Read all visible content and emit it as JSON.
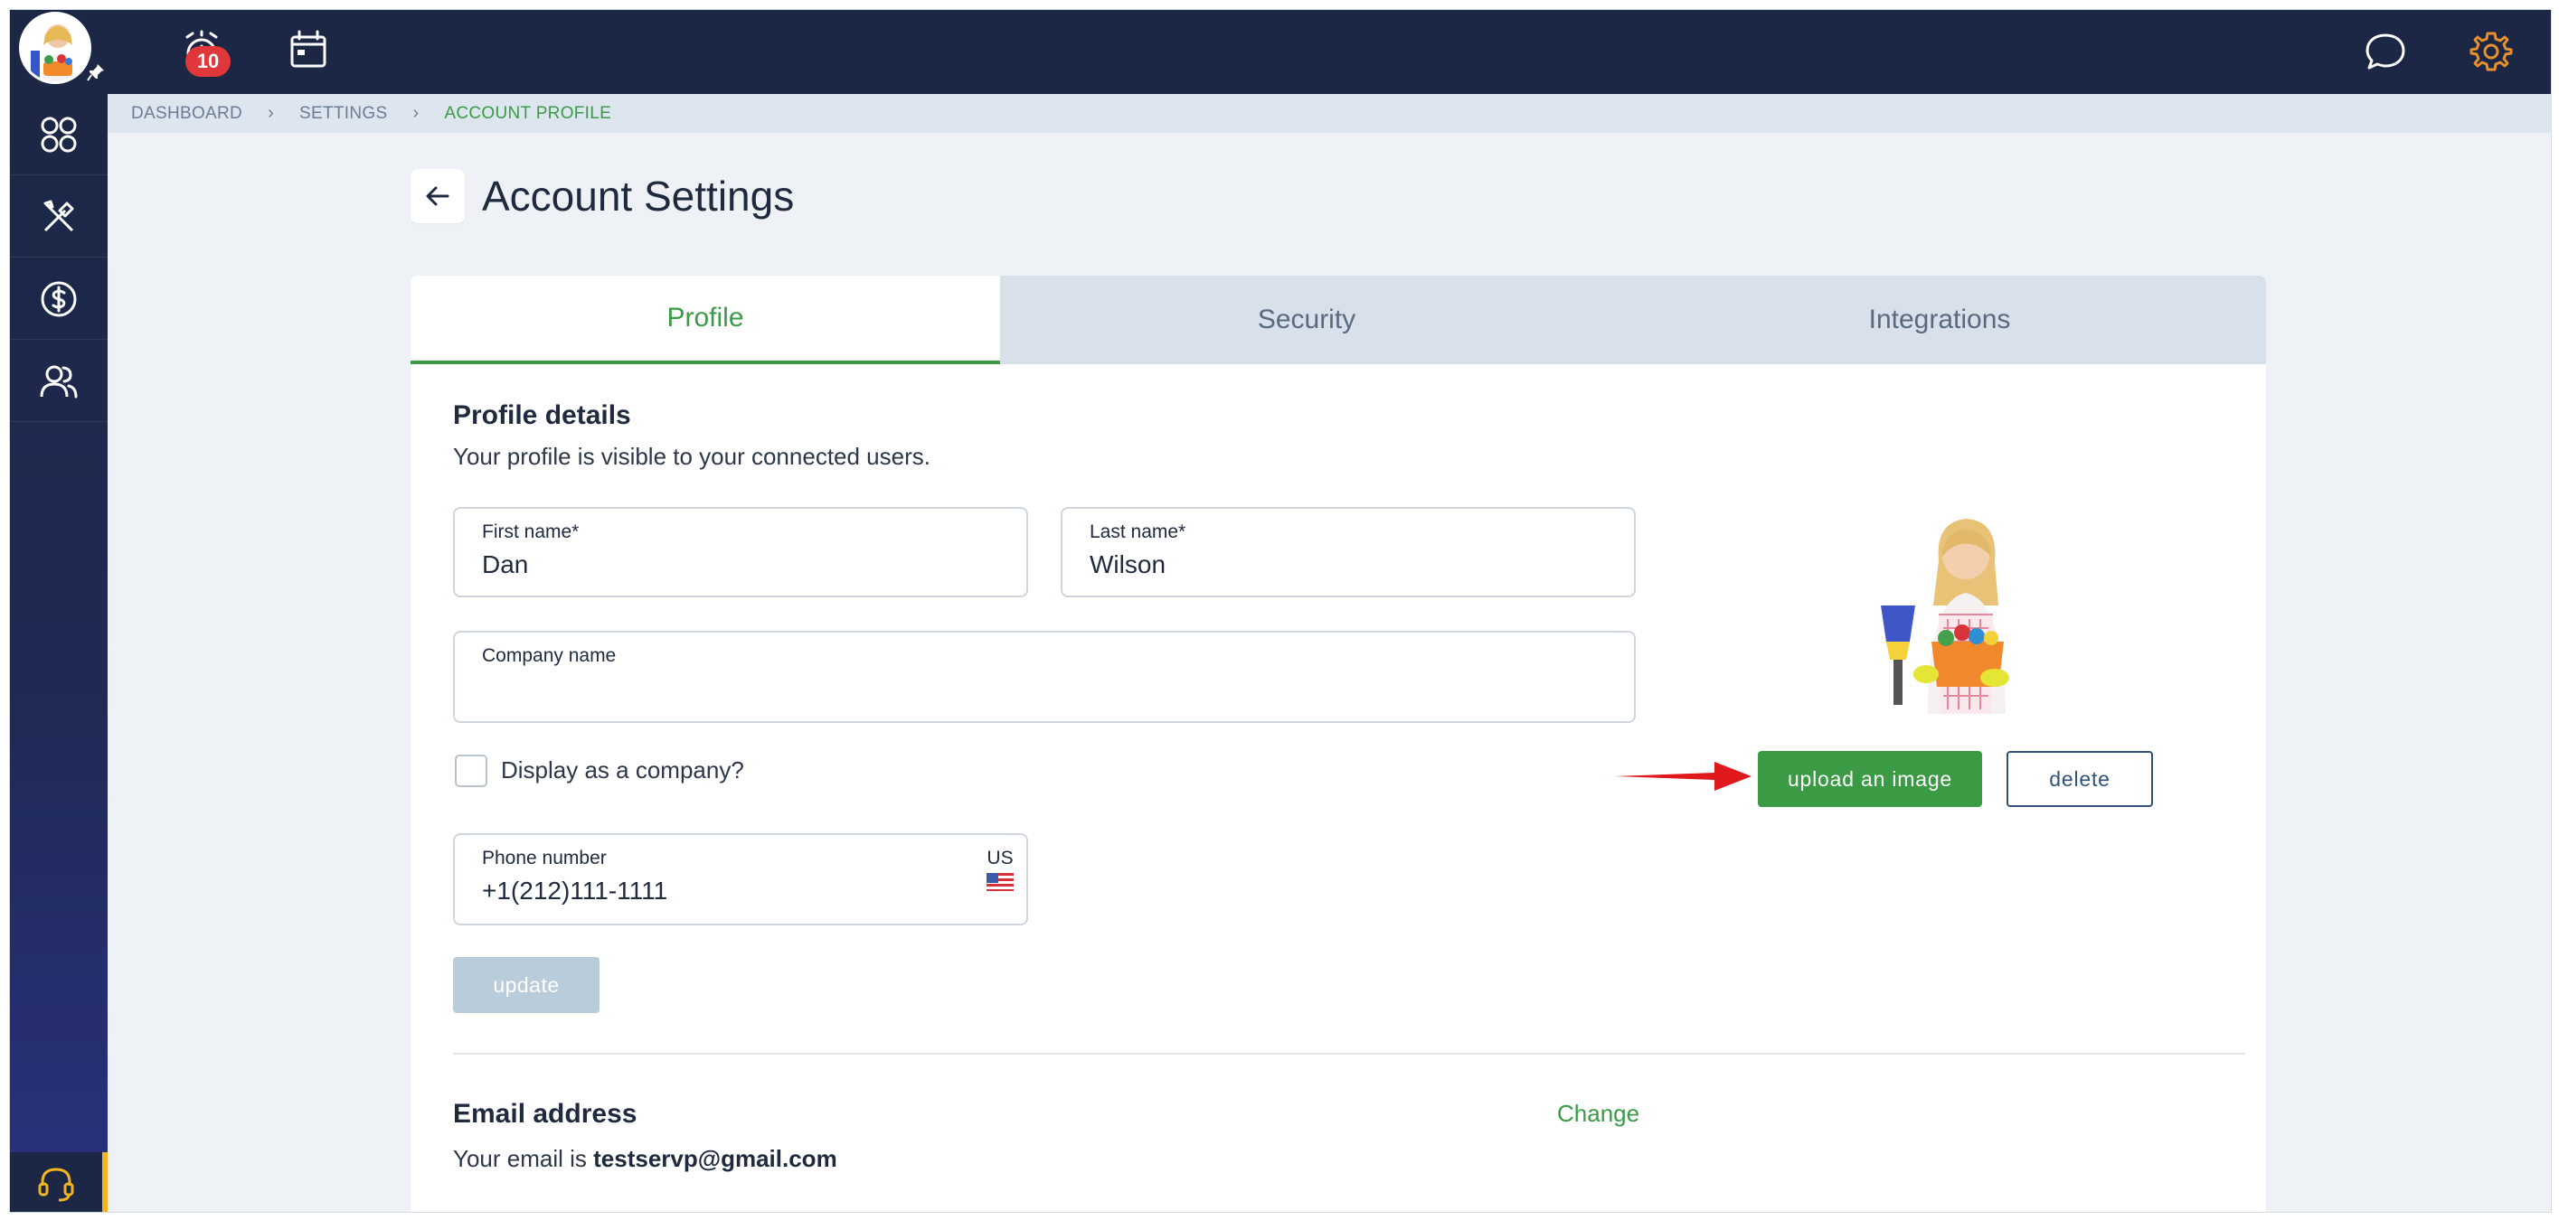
{
  "header": {
    "notification_count": "10"
  },
  "breadcrumb": {
    "items": [
      "DASHBOARD",
      "SETTINGS",
      "ACCOUNT PROFILE"
    ]
  },
  "page": {
    "title": "Account Settings"
  },
  "tabs": [
    {
      "label": "Profile",
      "active": true
    },
    {
      "label": "Security",
      "active": false
    },
    {
      "label": "Integrations",
      "active": false
    }
  ],
  "profile": {
    "section_title": "Profile details",
    "section_subtitle": "Your profile is visible to your connected users.",
    "first_name": {
      "label": "First name*",
      "value": "Dan"
    },
    "last_name": {
      "label": "Last name*",
      "value": "Wilson"
    },
    "company_name": {
      "label": "Company name",
      "value": ""
    },
    "display_as_company": {
      "label": "Display as a company?",
      "checked": false
    },
    "phone": {
      "label": "Phone number",
      "value": "+1(212)111-1111",
      "country": "US"
    },
    "update_label": "update",
    "upload_label": "upload an image",
    "delete_label": "delete"
  },
  "email": {
    "section_title": "Email address",
    "change_label": "Change",
    "prefix": "Your email is",
    "address": "testservp@gmail.com"
  },
  "colors": {
    "brand_navy": "#1b2744",
    "accent_green": "#3b9b46",
    "badge_red": "#e0373b",
    "support_yellow": "#f2b51e",
    "settings_orange": "#e8912c",
    "annotation_red": "#e0191d"
  },
  "icons": {
    "sidebar": [
      "dashboard-grid-icon",
      "tools-icon",
      "dollar-icon",
      "users-icon"
    ],
    "bottom": "headset-icon",
    "top": [
      "alarm-icon",
      "calendar-icon",
      "chat-icon",
      "gear-icon"
    ]
  }
}
